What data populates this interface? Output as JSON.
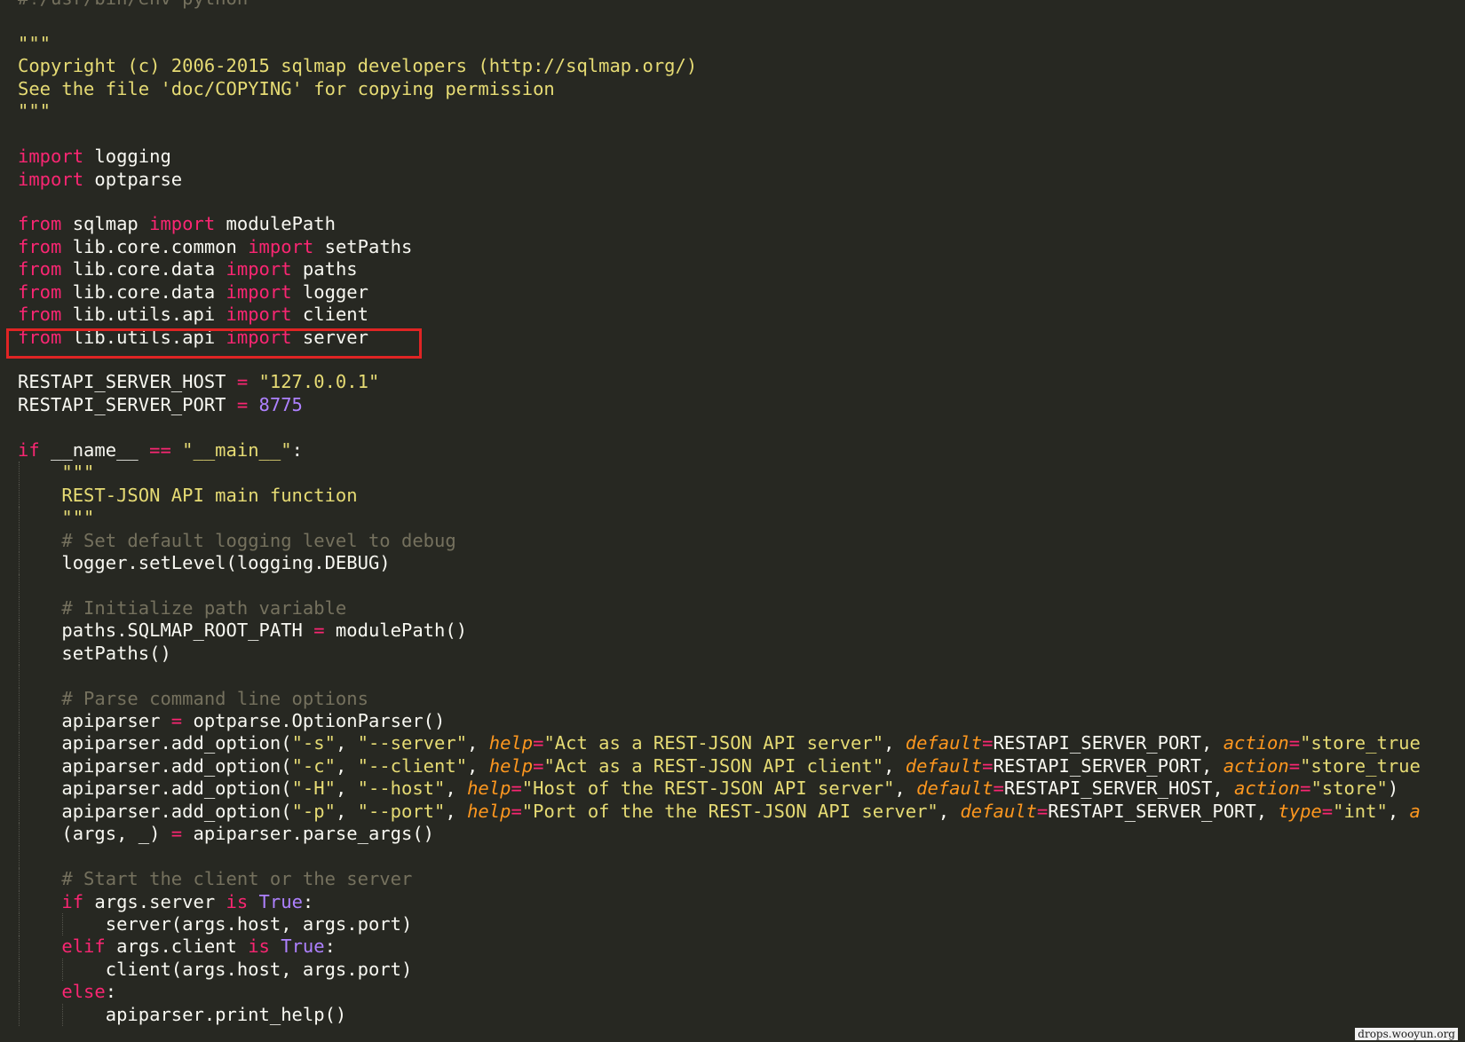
{
  "editor": {
    "theme_colors": {
      "background": "#272822",
      "keyword": "#f92672",
      "string": "#e6db74",
      "comment": "#75715e",
      "number": "#ae81ff",
      "argument": "#fd971f",
      "text": "#f8f8f2",
      "highlight_box": "#e02424"
    },
    "highlighted_line_index": 15,
    "watermark": "drops.wooyun.org",
    "lines": [
      [
        {
          "t": "#!/usr/bin/env python",
          "c": "cm"
        }
      ],
      [],
      [
        {
          "t": "\"\"\"",
          "c": "str"
        }
      ],
      [
        {
          "t": "Copyright (c) 2006-2015 sqlmap developers (http://sqlmap.org/)",
          "c": "str"
        }
      ],
      [
        {
          "t": "See the file 'doc/COPYING' for copying permission",
          "c": "str"
        }
      ],
      [
        {
          "t": "\"\"\"",
          "c": "str"
        }
      ],
      [],
      [
        {
          "t": "import",
          "c": "kw"
        },
        {
          "t": " logging"
        }
      ],
      [
        {
          "t": "import",
          "c": "kw"
        },
        {
          "t": " optparse"
        }
      ],
      [],
      [
        {
          "t": "from",
          "c": "kw"
        },
        {
          "t": " sqlmap "
        },
        {
          "t": "import",
          "c": "kw"
        },
        {
          "t": " modulePath"
        }
      ],
      [
        {
          "t": "from",
          "c": "kw"
        },
        {
          "t": " lib.core.common "
        },
        {
          "t": "import",
          "c": "kw"
        },
        {
          "t": " setPaths"
        }
      ],
      [
        {
          "t": "from",
          "c": "kw"
        },
        {
          "t": " lib.core.data "
        },
        {
          "t": "import",
          "c": "kw"
        },
        {
          "t": " paths"
        }
      ],
      [
        {
          "t": "from",
          "c": "kw"
        },
        {
          "t": " lib.core.data "
        },
        {
          "t": "import",
          "c": "kw"
        },
        {
          "t": " logger"
        }
      ],
      [
        {
          "t": "from",
          "c": "kw"
        },
        {
          "t": " lib.utils.api "
        },
        {
          "t": "import",
          "c": "kw"
        },
        {
          "t": " client"
        }
      ],
      [
        {
          "t": "from",
          "c": "kw"
        },
        {
          "t": " lib.utils.api "
        },
        {
          "t": "import",
          "c": "kw"
        },
        {
          "t": " server"
        }
      ],
      [],
      [
        {
          "t": "RESTAPI_SERVER_HOST "
        },
        {
          "t": "=",
          "c": "op"
        },
        {
          "t": " "
        },
        {
          "t": "\"127.0.0.1\"",
          "c": "str"
        }
      ],
      [
        {
          "t": "RESTAPI_SERVER_PORT "
        },
        {
          "t": "=",
          "c": "op"
        },
        {
          "t": " "
        },
        {
          "t": "8775",
          "c": "num"
        }
      ],
      [],
      [
        {
          "t": "if",
          "c": "kw"
        },
        {
          "t": " __name__ "
        },
        {
          "t": "==",
          "c": "op"
        },
        {
          "t": " "
        },
        {
          "t": "\"__main__\"",
          "c": "str"
        },
        {
          "t": ":"
        }
      ],
      [
        {
          "t": "    "
        },
        {
          "t": "\"\"\"",
          "c": "str"
        }
      ],
      [
        {
          "t": "    "
        },
        {
          "t": "REST-JSON API main function",
          "c": "str"
        }
      ],
      [
        {
          "t": "    "
        },
        {
          "t": "\"\"\"",
          "c": "str"
        }
      ],
      [
        {
          "t": "    "
        },
        {
          "t": "# Set default logging level to debug",
          "c": "cm"
        }
      ],
      [
        {
          "t": "    logger.setLevel(logging.DEBUG)"
        }
      ],
      [],
      [
        {
          "t": "    "
        },
        {
          "t": "# Initialize path variable",
          "c": "cm"
        }
      ],
      [
        {
          "t": "    paths.SQLMAP_ROOT_PATH "
        },
        {
          "t": "=",
          "c": "op"
        },
        {
          "t": " modulePath()"
        }
      ],
      [
        {
          "t": "    setPaths()"
        }
      ],
      [],
      [
        {
          "t": "    "
        },
        {
          "t": "# Parse command line options",
          "c": "cm"
        }
      ],
      [
        {
          "t": "    apiparser "
        },
        {
          "t": "=",
          "c": "op"
        },
        {
          "t": " optparse.OptionParser()"
        }
      ],
      [
        {
          "t": "    apiparser.add_option("
        },
        {
          "t": "\"-s\"",
          "c": "str"
        },
        {
          "t": ", "
        },
        {
          "t": "\"--server\"",
          "c": "str"
        },
        {
          "t": ", "
        },
        {
          "t": "help",
          "c": "arg"
        },
        {
          "t": "=",
          "c": "op"
        },
        {
          "t": "\"Act as a REST-JSON API server\"",
          "c": "str"
        },
        {
          "t": ", "
        },
        {
          "t": "default",
          "c": "arg"
        },
        {
          "t": "=",
          "c": "op"
        },
        {
          "t": "RESTAPI_SERVER_PORT, "
        },
        {
          "t": "action",
          "c": "arg"
        },
        {
          "t": "=",
          "c": "op"
        },
        {
          "t": "\"store_true",
          "c": "str"
        }
      ],
      [
        {
          "t": "    apiparser.add_option("
        },
        {
          "t": "\"-c\"",
          "c": "str"
        },
        {
          "t": ", "
        },
        {
          "t": "\"--client\"",
          "c": "str"
        },
        {
          "t": ", "
        },
        {
          "t": "help",
          "c": "arg"
        },
        {
          "t": "=",
          "c": "op"
        },
        {
          "t": "\"Act as a REST-JSON API client\"",
          "c": "str"
        },
        {
          "t": ", "
        },
        {
          "t": "default",
          "c": "arg"
        },
        {
          "t": "=",
          "c": "op"
        },
        {
          "t": "RESTAPI_SERVER_PORT, "
        },
        {
          "t": "action",
          "c": "arg"
        },
        {
          "t": "=",
          "c": "op"
        },
        {
          "t": "\"store_true",
          "c": "str"
        }
      ],
      [
        {
          "t": "    apiparser.add_option("
        },
        {
          "t": "\"-H\"",
          "c": "str"
        },
        {
          "t": ", "
        },
        {
          "t": "\"--host\"",
          "c": "str"
        },
        {
          "t": ", "
        },
        {
          "t": "help",
          "c": "arg"
        },
        {
          "t": "=",
          "c": "op"
        },
        {
          "t": "\"Host of the REST-JSON API server\"",
          "c": "str"
        },
        {
          "t": ", "
        },
        {
          "t": "default",
          "c": "arg"
        },
        {
          "t": "=",
          "c": "op"
        },
        {
          "t": "RESTAPI_SERVER_HOST, "
        },
        {
          "t": "action",
          "c": "arg"
        },
        {
          "t": "=",
          "c": "op"
        },
        {
          "t": "\"store\"",
          "c": "str"
        },
        {
          "t": ")"
        }
      ],
      [
        {
          "t": "    apiparser.add_option("
        },
        {
          "t": "\"-p\"",
          "c": "str"
        },
        {
          "t": ", "
        },
        {
          "t": "\"--port\"",
          "c": "str"
        },
        {
          "t": ", "
        },
        {
          "t": "help",
          "c": "arg"
        },
        {
          "t": "=",
          "c": "op"
        },
        {
          "t": "\"Port of the the REST-JSON API server\"",
          "c": "str"
        },
        {
          "t": ", "
        },
        {
          "t": "default",
          "c": "arg"
        },
        {
          "t": "=",
          "c": "op"
        },
        {
          "t": "RESTAPI_SERVER_PORT, "
        },
        {
          "t": "type",
          "c": "arg"
        },
        {
          "t": "=",
          "c": "op"
        },
        {
          "t": "\"int\"",
          "c": "str"
        },
        {
          "t": ", "
        },
        {
          "t": "a",
          "c": "arg"
        }
      ],
      [
        {
          "t": "    (args, _) "
        },
        {
          "t": "=",
          "c": "op"
        },
        {
          "t": " apiparser.parse_args()"
        }
      ],
      [],
      [
        {
          "t": "    "
        },
        {
          "t": "# Start the client or the server",
          "c": "cm"
        }
      ],
      [
        {
          "t": "    "
        },
        {
          "t": "if",
          "c": "kw"
        },
        {
          "t": " args.server "
        },
        {
          "t": "is",
          "c": "kw"
        },
        {
          "t": " "
        },
        {
          "t": "True",
          "c": "num"
        },
        {
          "t": ":"
        }
      ],
      [
        {
          "t": "        server(args.host, args.port)"
        }
      ],
      [
        {
          "t": "    "
        },
        {
          "t": "elif",
          "c": "kw"
        },
        {
          "t": " args.client "
        },
        {
          "t": "is",
          "c": "kw"
        },
        {
          "t": " "
        },
        {
          "t": "True",
          "c": "num"
        },
        {
          "t": ":"
        }
      ],
      [
        {
          "t": "        client(args.host, args.port)"
        }
      ],
      [
        {
          "t": "    "
        },
        {
          "t": "else",
          "c": "kw"
        },
        {
          "t": ":"
        }
      ],
      [
        {
          "t": "        apiparser.print_help()"
        }
      ]
    ]
  }
}
